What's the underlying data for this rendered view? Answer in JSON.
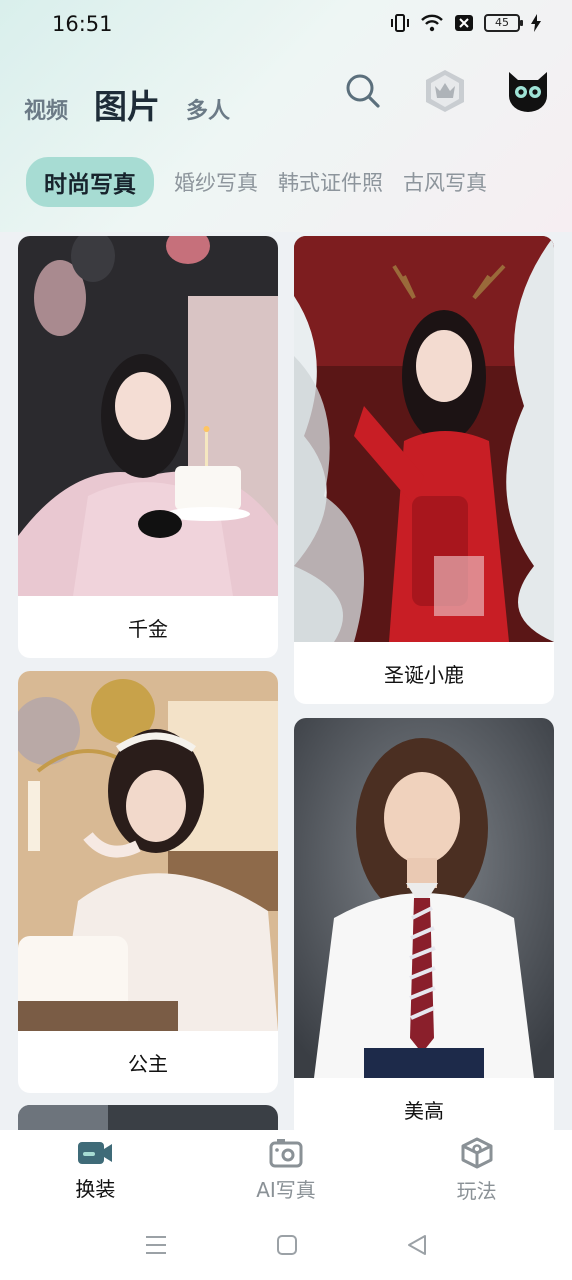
{
  "status_bar": {
    "time": "16:51",
    "battery": "45"
  },
  "top_nav": {
    "items": [
      "视频",
      "图片",
      "多人"
    ],
    "active_index": 1
  },
  "categories": {
    "items": [
      "时尚写真",
      "婚纱写真",
      "韩式证件照",
      "古风写真"
    ],
    "active_index": 0
  },
  "cards": [
    {
      "title": "千金"
    },
    {
      "title": "圣诞小鹿"
    },
    {
      "title": "公主"
    },
    {
      "title": "美高"
    }
  ],
  "bottom_nav": {
    "items": [
      {
        "label": "换装",
        "icon": "video-camera-icon"
      },
      {
        "label": "AI写真",
        "icon": "camera-icon"
      },
      {
        "label": "玩法",
        "icon": "cube-icon"
      }
    ],
    "active_index": 0
  },
  "colors": {
    "accent": "#a7dcd3",
    "active_icon": "#3f6b78",
    "inactive": "#8a9196"
  }
}
